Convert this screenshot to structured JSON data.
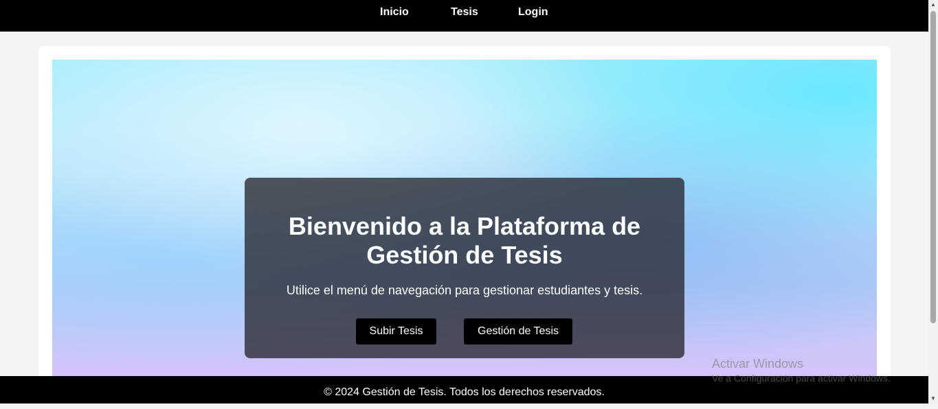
{
  "nav": {
    "items": [
      {
        "label": "Inicio"
      },
      {
        "label": "Tesis"
      },
      {
        "label": "Login"
      }
    ]
  },
  "hero": {
    "title": "Bienvenido a la Plataforma de Gestión de Tesis",
    "subtitle": "Utilice el menú de navegación para gestionar estudiantes y tesis.",
    "buttons": {
      "upload_label": "Subir Tesis",
      "manage_label": "Gestión de Tesis"
    }
  },
  "footer": {
    "text": "© 2024 Gestión de Tesis. Todos los derechos reservados."
  },
  "watermark": {
    "line1": "Activar Windows",
    "line2": "Ve a Configuración para activar Windows."
  },
  "colors": {
    "nav_bg": "#000000",
    "button_bg": "#000000",
    "overlay_bg": "#28283a"
  },
  "icons": {
    "scroll_up": "scroll-up-arrow-icon",
    "scroll_down": "scroll-down-arrow-icon"
  }
}
